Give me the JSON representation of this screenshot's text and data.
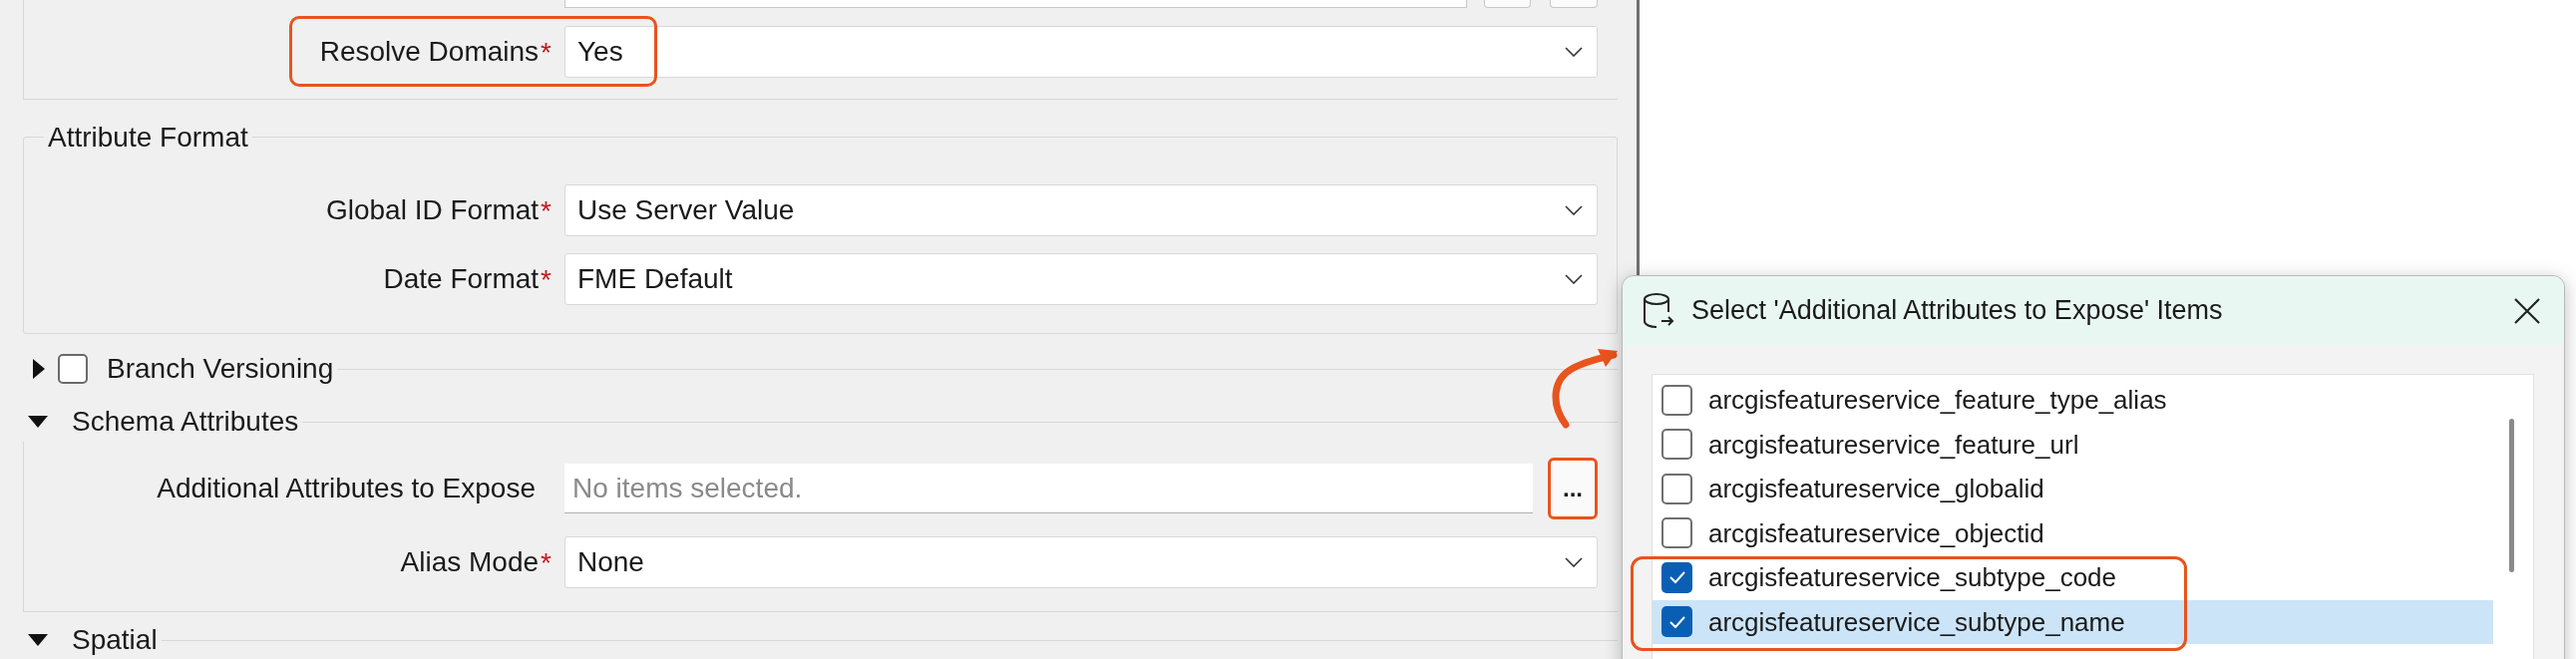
{
  "top_section": {
    "fields": [
      {
        "kind": "select",
        "label": "Resolve Domains",
        "required_mark": "*",
        "value": "Yes",
        "annotated": true
      }
    ]
  },
  "groups": [
    {
      "kind": "box",
      "title": "Attribute Format",
      "fields": [
        {
          "kind": "select",
          "label": "Global ID Format",
          "required_mark": "*",
          "value": "Use Server Value",
          "annotated": false
        },
        {
          "kind": "select",
          "label": "Date Format",
          "required_mark": "*",
          "value": "FME Default",
          "annotated": false
        }
      ]
    },
    {
      "kind": "collapsible",
      "title": "Branch Versioning",
      "expanded": false,
      "checked": false
    },
    {
      "kind": "collapsible",
      "title": "Schema Attributes",
      "expanded": true,
      "fields": [
        {
          "kind": "picker",
          "label": "Additional Attributes to Expose",
          "placeholder": "No items selected.",
          "button": "...",
          "annotated": true
        },
        {
          "kind": "select",
          "label": "Alias Mode",
          "required_mark": "*",
          "value": "None",
          "annotated": false
        }
      ]
    },
    {
      "kind": "collapsible",
      "title": "Spatial",
      "expanded": true
    }
  ],
  "dialog": {
    "title": "Select 'Additional Attributes to Expose' Items",
    "items": [
      {
        "label": "arcgisfeatureservice_feature_type_alias",
        "checked": false,
        "selected": false,
        "annotated": false
      },
      {
        "label": "arcgisfeatureservice_feature_url",
        "checked": false,
        "selected": false,
        "annotated": false
      },
      {
        "label": "arcgisfeatureservice_globalid",
        "checked": false,
        "selected": false,
        "annotated": false
      },
      {
        "label": "arcgisfeatureservice_objectid",
        "checked": false,
        "selected": false,
        "annotated": false
      },
      {
        "label": "arcgisfeatureservice_subtype_code",
        "checked": true,
        "selected": false,
        "annotated": true
      },
      {
        "label": "arcgisfeatureservice_subtype_name",
        "checked": true,
        "selected": true,
        "annotated": true
      }
    ]
  }
}
